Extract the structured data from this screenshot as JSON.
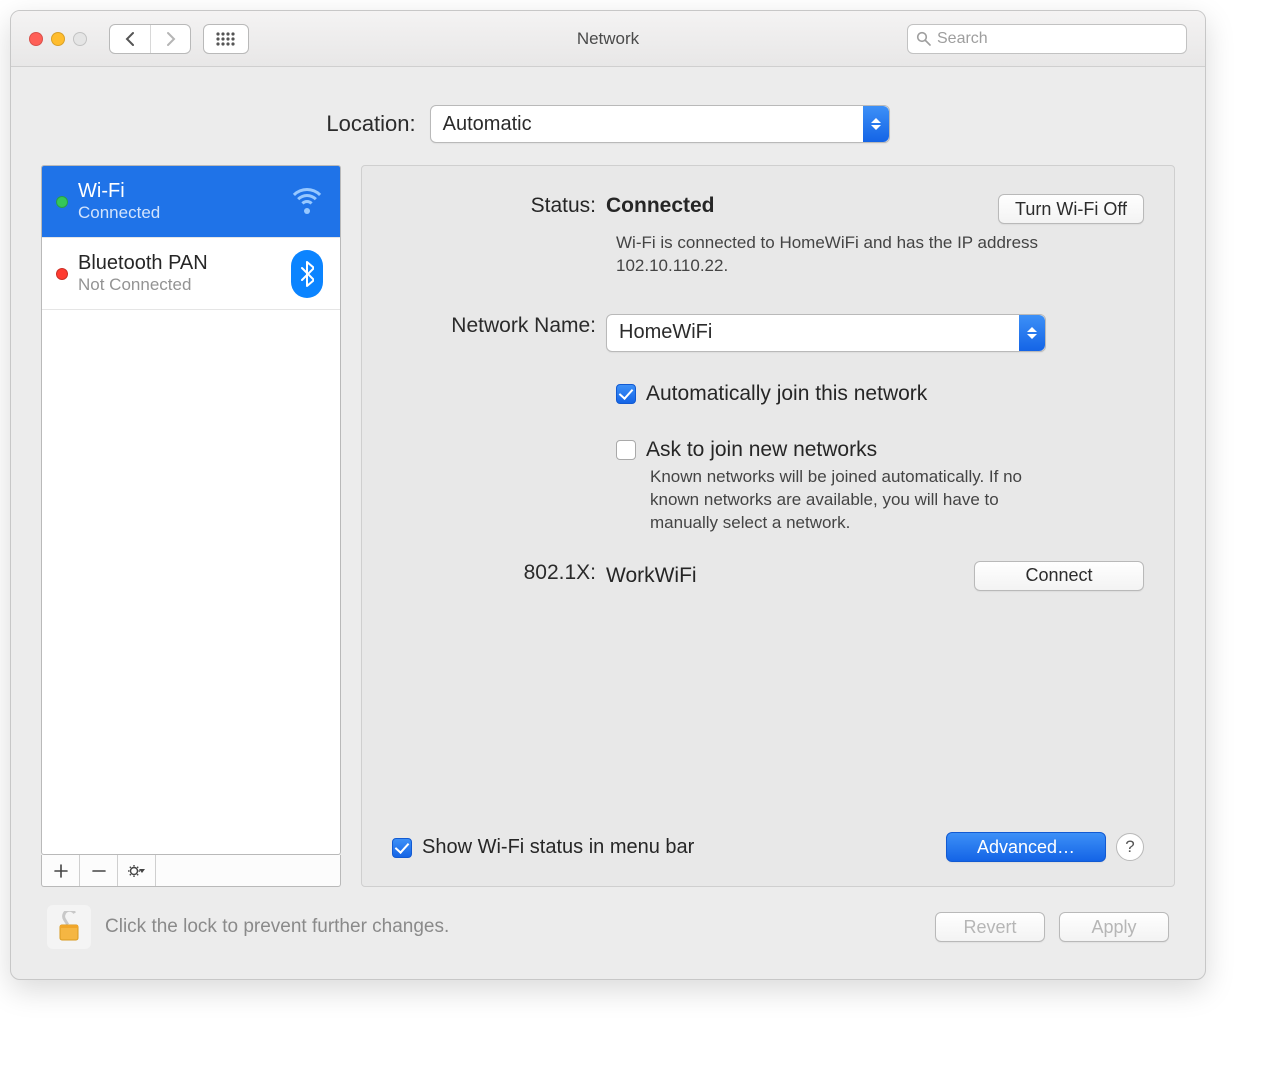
{
  "window": {
    "title": "Network"
  },
  "search": {
    "placeholder": "Search"
  },
  "location": {
    "label": "Location:",
    "value": "Automatic"
  },
  "sidebar": {
    "services": [
      {
        "name": "Wi-Fi",
        "state": "Connected",
        "status_color": "green",
        "icon": "wifi",
        "selected": true
      },
      {
        "name": "Bluetooth PAN",
        "state": "Not Connected",
        "status_color": "red",
        "icon": "bluetooth",
        "selected": false
      }
    ]
  },
  "detail": {
    "status_label": "Status:",
    "status_value": "Connected",
    "wifi_toggle": "Turn Wi-Fi Off",
    "status_desc": "Wi-Fi is connected to HomeWiFi and has the IP address 102.10.110.22.",
    "network_name_label": "Network Name:",
    "network_name_value": "HomeWiFi",
    "auto_join": {
      "checked": true,
      "label": "Automatically join this network"
    },
    "ask_join": {
      "checked": false,
      "label": "Ask to join new networks",
      "help": "Known networks will be joined automatically. If no known networks are available, you will have to manually select a network."
    },
    "authx_label": "802.1X:",
    "authx_value": "WorkWiFi",
    "authx_button": "Connect",
    "show_menu": {
      "checked": true,
      "label": "Show Wi-Fi status in menu bar"
    },
    "advanced_button": "Advanced…"
  },
  "bottombar": {
    "lock_msg": "Click the lock to prevent further changes.",
    "revert": "Revert",
    "apply": "Apply"
  }
}
